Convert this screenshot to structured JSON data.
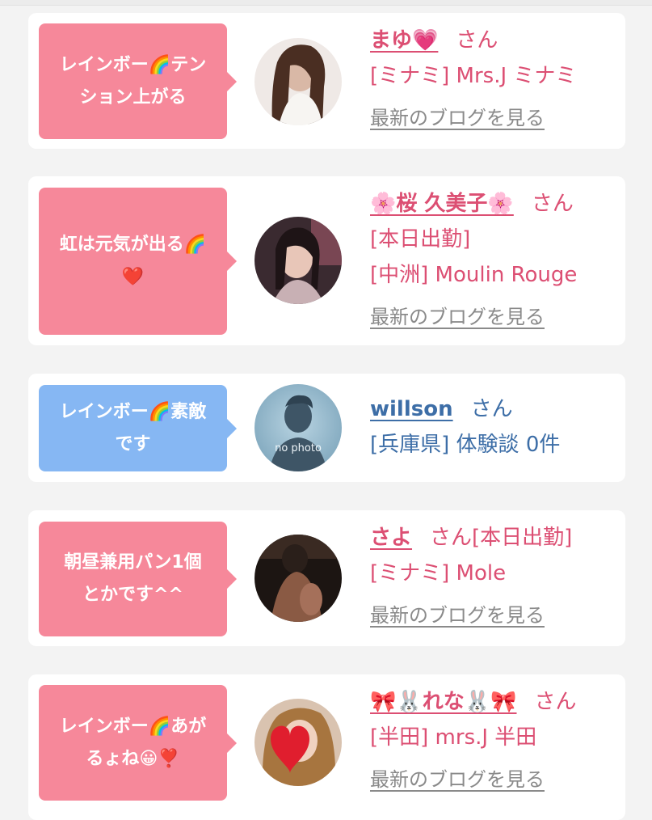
{
  "colors": {
    "page_bg": "#f3f3f3",
    "card_bg": "#ffffff",
    "bubble_pink": "#f6889a",
    "bubble_blue": "#86b7f3",
    "name_pink": "#dc4f73",
    "name_blue": "#3d6ea7",
    "blog_link": "#8a8a8a"
  },
  "comments": [
    {
      "bubble_text": "レインボー🌈テン\nション上がる",
      "bubble_color": "pink",
      "name": "まゆ💗",
      "san": "さん",
      "lines": [
        "[ミナミ] Mrs.J ミナミ"
      ],
      "blog_link": "最新のブログを見る",
      "avatar": "woman-long-hair-photo"
    },
    {
      "bubble_text": "虹は元気が出る🌈\n❤️",
      "bubble_color": "pink",
      "name": "🌸桜 久美子🌸",
      "san": "さん",
      "lines": [
        "[本日出勤]",
        "[中洲] Moulin Rouge"
      ],
      "blog_link": "最新のブログを見る",
      "avatar": "woman-dark-hair-photo"
    },
    {
      "bubble_text": "レインボー🌈素敵\nです",
      "bubble_color": "blue",
      "name": "willson",
      "san": "さん",
      "lines": [
        "[兵庫県] 体験談 0件"
      ],
      "blog_link": "",
      "avatar": "no-photo-silhouette",
      "avatar_label": "no photo"
    },
    {
      "bubble_text": "朝昼兼用パン1個\nとかです^^",
      "bubble_color": "pink",
      "name": "さよ",
      "san": "さん[本日出勤]",
      "lines": [
        "[ミナミ] Mole"
      ],
      "blog_link": "最新のブログを見る",
      "avatar": "dim-room-photo"
    },
    {
      "bubble_text": "レインボー🌈あが\nるょね😀❣️",
      "bubble_color": "pink",
      "name": "🎀🐰れな🐰🎀",
      "san": "さん",
      "lines": [
        "[半田] mrs.J 半田"
      ],
      "blog_link": "最新のブログを見る",
      "avatar": "heart-covered-face-photo"
    }
  ]
}
